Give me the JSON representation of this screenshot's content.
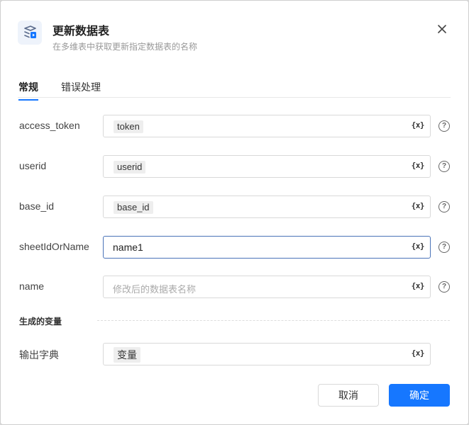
{
  "dialog": {
    "title": "更新数据表",
    "subtitle": "在多维表中获取更新指定数据表的名称",
    "icon": "table-icon",
    "accent": "#1677ff"
  },
  "tabs": [
    {
      "label": "常规",
      "active": true
    },
    {
      "label": "错误处理",
      "active": false
    }
  ],
  "fields": [
    {
      "label": "access_token",
      "value": "token",
      "kind": "chip"
    },
    {
      "label": "userid",
      "value": "userid",
      "kind": "chip"
    },
    {
      "label": "base_id",
      "value": "base_id",
      "kind": "chip"
    },
    {
      "label": "sheetIdOrName",
      "value": "name1",
      "kind": "text"
    },
    {
      "label": "name",
      "placeholder": "修改后的数据表名称",
      "kind": "placeholder"
    }
  ],
  "variable_icon_text": "{x}",
  "help_icon_text": "?",
  "output_section": {
    "title": "生成的变量",
    "label": "输出字典",
    "value": "变量"
  },
  "buttons": {
    "cancel": "取消",
    "ok": "确定"
  }
}
